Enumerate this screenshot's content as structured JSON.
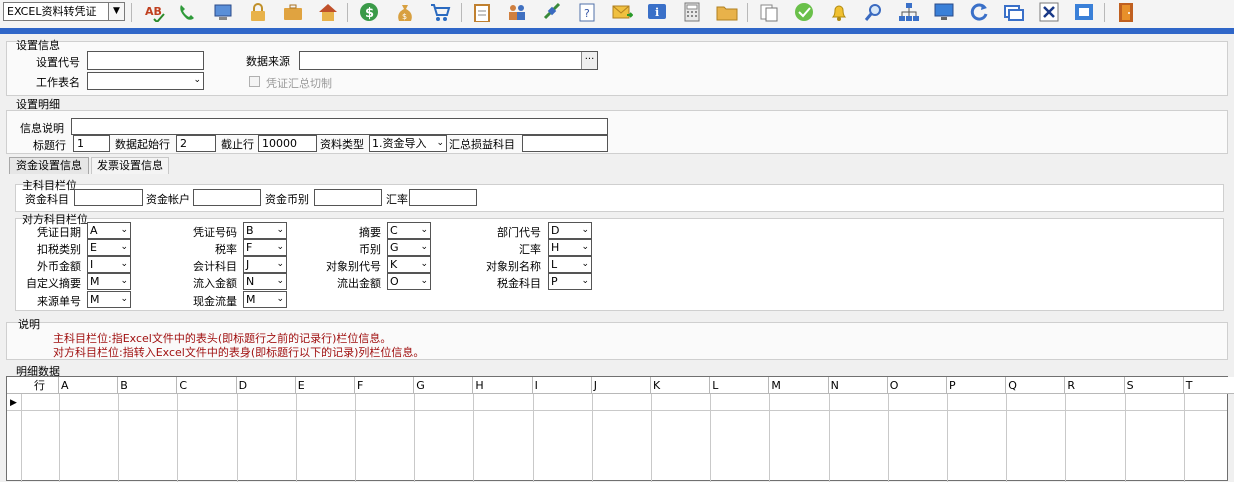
{
  "toolbar": {
    "module": "EXCEL资料转凭证",
    "icons": [
      "spellcheck-icon",
      "phone-icon",
      "computer-icon",
      "lock-icon",
      "briefcase-icon",
      "home-icon",
      "dollar-icon",
      "money-bag-icon",
      "cart-icon",
      "clipboard-icon",
      "users-icon",
      "link-icon",
      "help-icon",
      "mail-icon",
      "info-icon",
      "calculator-icon",
      "folder-icon",
      "documents-icon",
      "check-icon",
      "bell-icon",
      "search-icon",
      "org-chart-icon",
      "monitor-icon",
      "refresh-icon",
      "window-icon",
      "close-icon",
      "restore-icon",
      "exit-door-icon"
    ]
  },
  "settings_info": {
    "title": "设置信息",
    "setting_code_label": "设置代号",
    "setting_code_value": "",
    "data_source_label": "数据来源",
    "data_source_value": "",
    "browse_label": "···",
    "sheet_name_label": "工作表名",
    "sheet_name_value": "",
    "voucher_split_label": "凭证汇总切制"
  },
  "settings_detail": {
    "title": "设置明细",
    "info_desc_label": "信息说明",
    "info_desc_value": "",
    "title_row_label": "标题行",
    "title_row_value": "1",
    "data_start_label": "数据起始行",
    "data_start_value": "2",
    "stop_row_label": "截止行",
    "stop_row_value": "10000",
    "data_type_label": "资料类型",
    "data_type_value": "1.资金导入",
    "summary_account_label": "汇总损益科目",
    "summary_account_value": ""
  },
  "tabs": [
    "资金设置信息",
    "发票设置信息"
  ],
  "main_account": {
    "title": "主科目栏位",
    "fund_account_label": "资金科目",
    "fund_bank_label": "资金帐户",
    "fund_currency_label": "资金币别",
    "rate_label": "汇率"
  },
  "counter_account": {
    "title": "对方科目栏位",
    "fields": [
      {
        "label": "凭证日期",
        "value": "A"
      },
      {
        "label": "凭证号码",
        "value": "B"
      },
      {
        "label": "摘要",
        "value": "C"
      },
      {
        "label": "部门代号",
        "value": "D"
      },
      {
        "label": "扣税类别",
        "value": "E"
      },
      {
        "label": "税率",
        "value": "F"
      },
      {
        "label": "币别",
        "value": "G"
      },
      {
        "label": "汇率",
        "value": "H"
      },
      {
        "label": "外币金额",
        "value": "I"
      },
      {
        "label": "会计科目",
        "value": "J"
      },
      {
        "label": "对象别代号",
        "value": "K"
      },
      {
        "label": "对象别名称",
        "value": "L"
      },
      {
        "label": "自定义摘要",
        "value": "M"
      },
      {
        "label": "流入金额",
        "value": "N"
      },
      {
        "label": "流出金额",
        "value": "O"
      },
      {
        "label": "税金科目",
        "value": "P"
      },
      {
        "label": "来源单号",
        "value": "M"
      },
      {
        "label": "现金流量",
        "value": "M"
      }
    ]
  },
  "explanation": {
    "title": "说明",
    "line1": "主科目栏位:指Excel文件中的表头(即标题行之前的记录行)栏位信息。",
    "line2": "对方科目栏位:指转入Excel文件中的表身(即标题行以下的记录)列栏位信息。",
    "color": "#a01010"
  },
  "detail_data": {
    "title": "明细数据",
    "row_header": "行",
    "columns": [
      "A",
      "B",
      "C",
      "D",
      "E",
      "F",
      "G",
      "H",
      "I",
      "J",
      "K",
      "L",
      "M",
      "N",
      "O",
      "P",
      "Q",
      "R",
      "S",
      "T"
    ]
  }
}
